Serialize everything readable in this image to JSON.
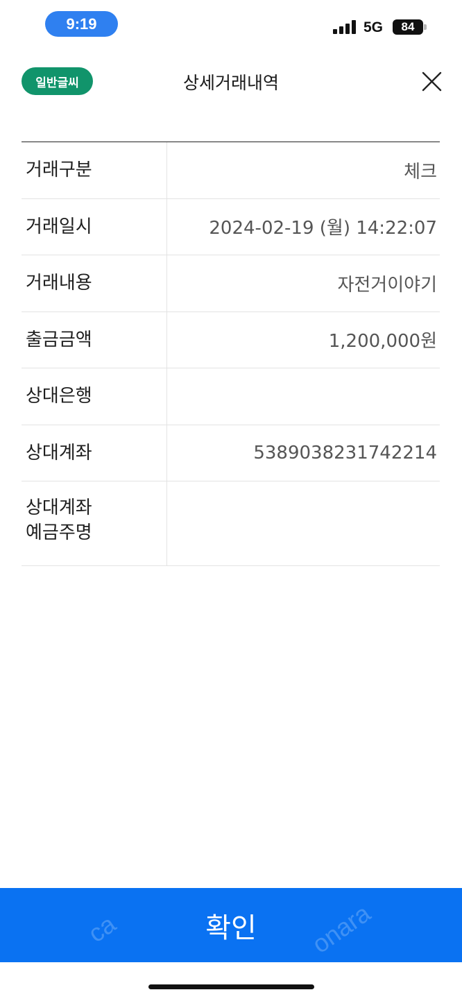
{
  "status_bar": {
    "time": "9:19",
    "network": "5G",
    "battery": "84"
  },
  "header": {
    "font_badge": "일반글씨",
    "title": "상세거래내역",
    "close_icon": "close-icon"
  },
  "details": [
    {
      "label": "거래구분",
      "value": "체크"
    },
    {
      "label": "거래일시",
      "value": "2024-02-19 (월) 14:22:07"
    },
    {
      "label": "거래내용",
      "value": "자전거이야기"
    },
    {
      "label": "출금금액",
      "value": "1,200,000원"
    },
    {
      "label": "상대은행",
      "value": ""
    },
    {
      "label": "상대계좌",
      "value": "5389038231742214"
    },
    {
      "label": "상대계좌\n예금주명",
      "value": ""
    }
  ],
  "confirm_button": {
    "label": "확인"
  },
  "colors": {
    "accent_blue": "#0a72f2",
    "badge_green": "#11946b",
    "time_pill_blue": "#2f80f0"
  },
  "watermarks": [
    "ca",
    "onara"
  ]
}
